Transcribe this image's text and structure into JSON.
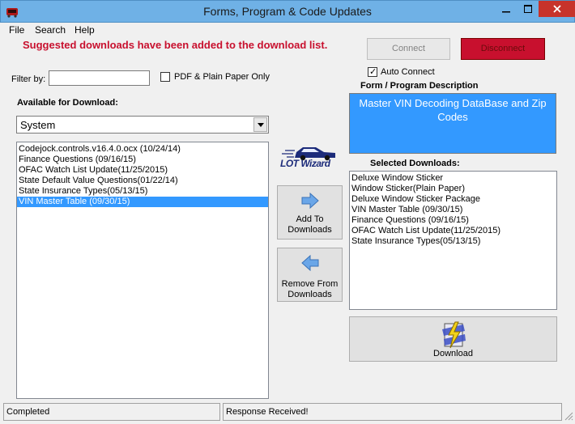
{
  "window": {
    "title": "Forms, Program & Code Updates",
    "controls": {
      "minimize": "minimize-icon",
      "maximize": "maximize-icon",
      "close": "close-icon"
    }
  },
  "menu": [
    {
      "label": "File"
    },
    {
      "label": "Search"
    },
    {
      "label": "Help"
    }
  ],
  "banner": "Suggested downloads have been added to the download list.",
  "filter": {
    "label": "Filter by:",
    "value": "",
    "pdf_only_label": "PDF & Plain Paper Only",
    "pdf_only_checked": false
  },
  "available": {
    "label": "Available for Download:",
    "system_select": "System",
    "items": [
      {
        "text": "Codejock.controls.v16.4.0.ocx (10/24/14)",
        "selected": false
      },
      {
        "text": "Finance Questions (09/16/15)",
        "selected": false
      },
      {
        "text": "OFAC Watch List Update(11/25/2015)",
        "selected": false
      },
      {
        "text": "State Default Value Questions(01/22/14)",
        "selected": false
      },
      {
        "text": "State Insurance Types(05/13/15)",
        "selected": false
      },
      {
        "text": "VIN Master Table (09/30/15)",
        "selected": true
      }
    ]
  },
  "connection": {
    "connect_label": "Connect",
    "disconnect_label": "Disconnect",
    "auto_connect_label": "Auto Connect",
    "auto_connect_checked": true
  },
  "description": {
    "label": "Form / Program Description",
    "text": "Master VIN Decoding DataBase and Zip Codes"
  },
  "logo_text": "LOT Wizard",
  "actions": {
    "add_label_1": "Add To",
    "add_label_2": "Downloads",
    "remove_label_1": "Remove From",
    "remove_label_2": "Downloads",
    "download_label": "Download"
  },
  "selected": {
    "label": "Selected Downloads:",
    "items": [
      "Deluxe Window Sticker",
      "Window Sticker(Plain Paper)",
      "Deluxe Window Sticker Package",
      "VIN Master Table (09/30/15)",
      "Finance Questions (09/16/15)",
      "OFAC Watch List Update(11/25/2015)",
      "State Insurance Types(05/13/15)"
    ]
  },
  "status": {
    "left": "Completed",
    "right": "Response Received!"
  },
  "colors": {
    "accent": "#3399ff",
    "banner": "#c8102e",
    "disconnect": "#c8102e",
    "titlebar": "#6fb1e6"
  }
}
